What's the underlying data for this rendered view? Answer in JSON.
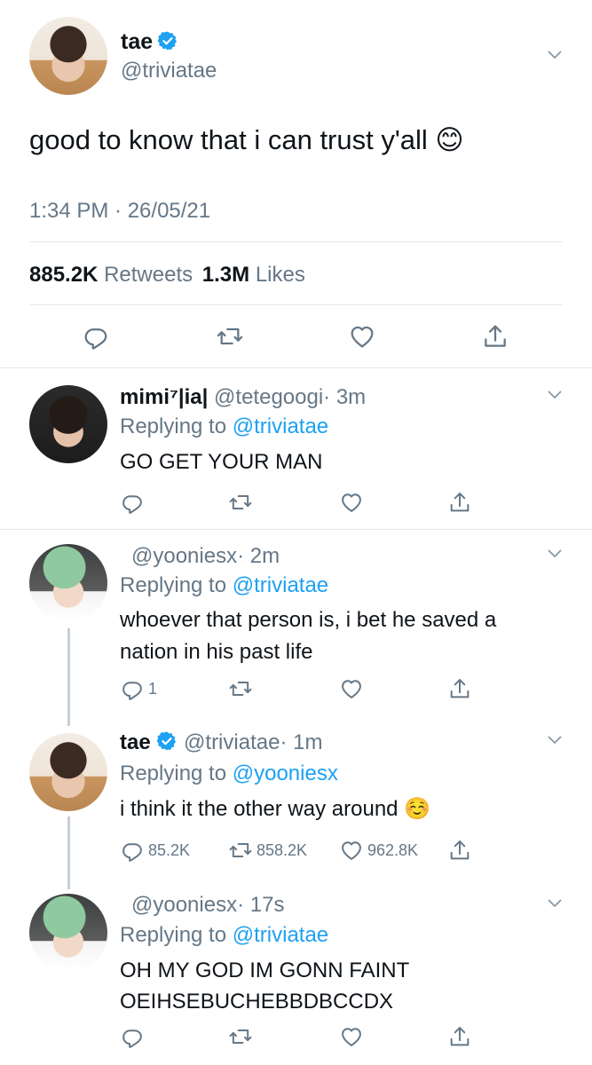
{
  "main_tweet": {
    "name": "tae",
    "handle": "@triviatae",
    "text": "good to know that i can trust y'all 😊",
    "timestamp": "1:34 PM · 26/05/21",
    "retweets_count": "885.2K",
    "retweets_label": "Retweets",
    "likes_count": "1.3M",
    "likes_label": "Likes"
  },
  "replies": [
    {
      "name": "mimi⁷|ia|",
      "handle": "@tetegoogi",
      "time": "· 3m",
      "replying_label": "Replying to",
      "replying_to": "@triviatae",
      "text": "GO GET YOUR MAN"
    },
    {
      "name": "",
      "handle": "@yooniesx",
      "time": "· 2m",
      "replying_label": "Replying to",
      "replying_to": "@triviatae",
      "text_line1": "whoever that person is, i bet he saved a",
      "text_line2": "nation in his past life",
      "reply_count": "1"
    },
    {
      "name": "tae",
      "handle": "@triviatae",
      "time": "· 1m",
      "replying_label": "Replying to",
      "replying_to": "@yooniesx",
      "text": "i think it the other way around ☺️",
      "reply_count": "85.2K",
      "retweet_count": "858.2K",
      "like_count": "962.8K"
    },
    {
      "name": "",
      "handle": "@yooniesx",
      "time": "· 17s",
      "replying_label": "Replying to",
      "replying_to": "@triviatae",
      "text_line1": "OH MY GOD IM GONN FAINT",
      "text_line2": "OEIHSEBUCHEBBDBCCDX"
    }
  ],
  "colors": {
    "link_blue": "#1da1f2",
    "gray_text": "#657786",
    "divider": "#e1e8ed",
    "verified_badge": "#1da1f2"
  },
  "icons": [
    "reply-icon",
    "retweet-icon",
    "like-icon",
    "share-icon",
    "verified-icon",
    "chevron-down-icon"
  ]
}
